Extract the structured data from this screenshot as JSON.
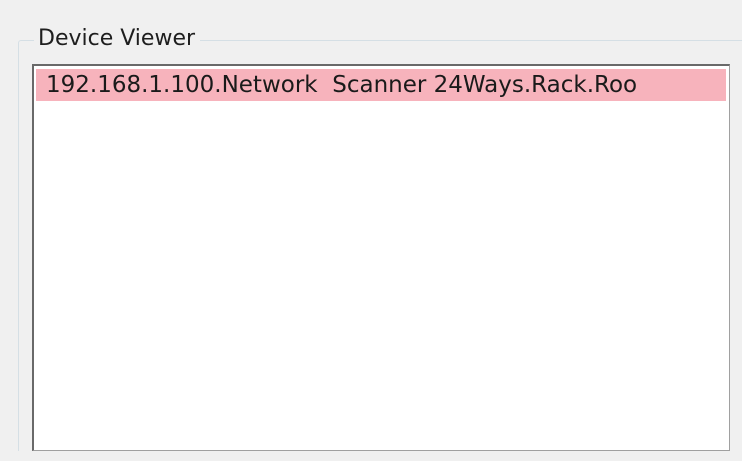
{
  "device_viewer": {
    "title": "Device Viewer",
    "items": [
      {
        "label": "192.168.1.100.Network  Scanner 24Ways.Rack.Roo",
        "selected": true
      }
    ]
  },
  "colors": {
    "window_background": "#f0f0f0",
    "list_background": "#ffffff",
    "selected_item_background": "#f7b3bc",
    "groupbox_border": "#d5dfe5"
  }
}
